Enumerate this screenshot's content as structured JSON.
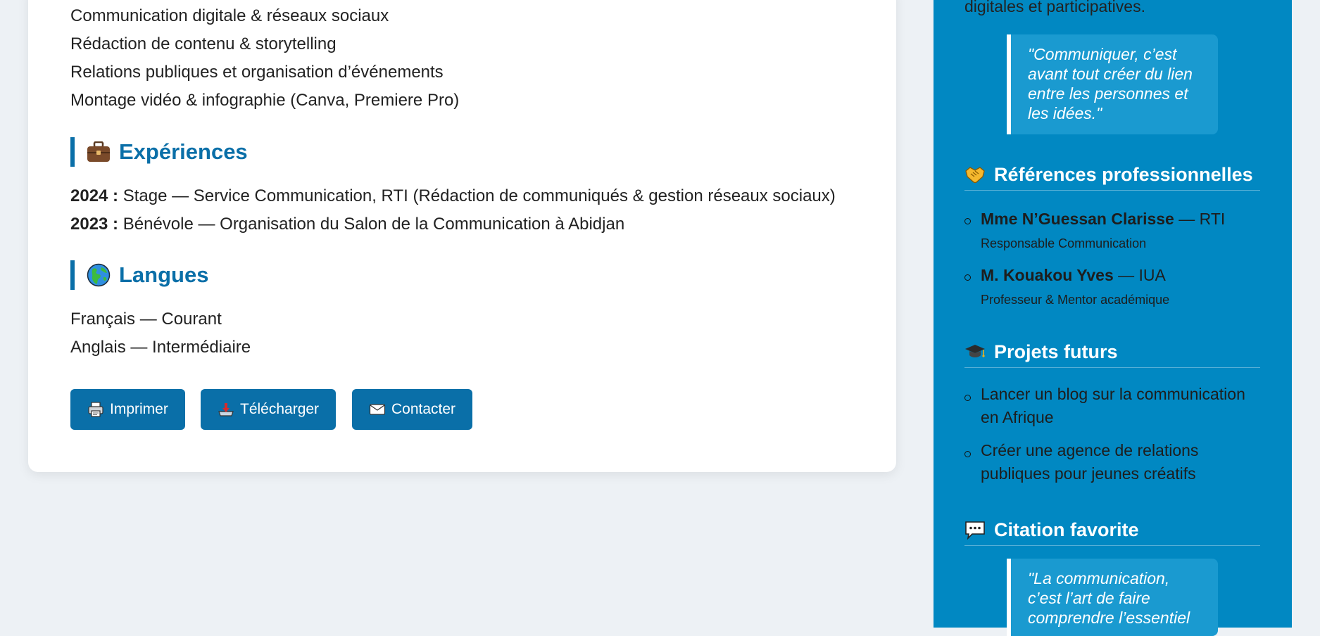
{
  "skills": [
    "Communication digitale & réseaux sociaux",
    "Rédaction de contenu & storytelling",
    "Relations publiques et organisation d’événements",
    "Montage vidéo & infographie (Canva, Premiere Pro)"
  ],
  "experiences": {
    "title": "Expériences",
    "items": [
      {
        "year": "2024 :",
        "text": "Stage — Service Communication, RTI (Rédaction de communiqués & gestion réseaux sociaux)"
      },
      {
        "year": "2023 :",
        "text": "Bénévole — Organisation du Salon de la Communication à Abidjan"
      }
    ]
  },
  "languages": {
    "title": "Langues",
    "items": [
      "Français — Courant",
      "Anglais — Intermédiaire"
    ]
  },
  "actions": {
    "print": "Imprimer",
    "download": "Télécharger",
    "contact": "Contacter"
  },
  "sidebar": {
    "intro_tail": "digitales et participatives.",
    "quote_top": [
      "\"Communiquer, c’est",
      "avant tout créer du lien",
      "entre les personnes et",
      "les idées.\""
    ],
    "references": {
      "title": "Références professionnelles",
      "items": [
        {
          "name": "Mme N’Guessan Clarisse",
          "org": " — RTI",
          "role": "Responsable Communication"
        },
        {
          "name": "M. Kouakou Yves",
          "org": " — IUA",
          "role": "Professeur & Mentor académique"
        }
      ]
    },
    "projects": {
      "title": "Projets futurs",
      "items": [
        [
          "Lancer un blog sur la communication",
          "en Afrique"
        ],
        [
          "Créer une agence de relations",
          "publiques pour jeunes créatifs"
        ]
      ]
    },
    "favorite_quote": {
      "title": "Citation favorite",
      "lines": [
        "\"La communication,",
        "c’est l’art de faire",
        "comprendre l’essentiel"
      ]
    }
  },
  "colors": {
    "accent": "#0a6fa8",
    "sidebar": "#0188c2",
    "page_bg": "#edf1f5"
  }
}
